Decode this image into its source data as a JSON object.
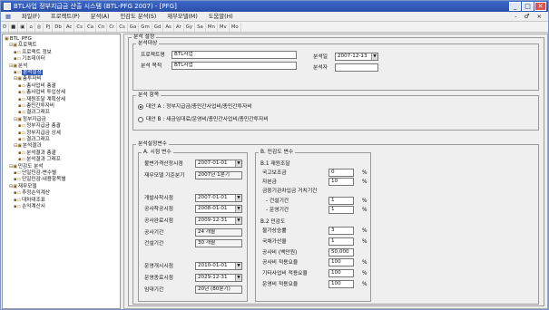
{
  "window": {
    "title": "BTL사업 정부지급금 산출 시스템 (BTL-PFG 2007) - [PFG]",
    "btn_min": "_",
    "btn_max": "□",
    "btn_close": "✕"
  },
  "menubar": {
    "items": [
      "파일(F)",
      "프로젝트(P)",
      "분석(A)",
      "민감도 분석(S)",
      "재무모델(M)",
      "도움말(H)"
    ],
    "mdi_controls": "- ♂ ×"
  },
  "toolbar": {
    "items": [
      "D",
      "■",
      "▣",
      "⌂",
      "◎",
      "Pj",
      "Db",
      "Ac",
      "Cs",
      "Ca",
      "Cn",
      "Cr",
      "Cs",
      "Ga",
      "Gm",
      "Gd",
      "As",
      "Ar",
      "Gy",
      "Sa",
      "Mn",
      "Mv",
      "Mo"
    ]
  },
  "tree": {
    "items": [
      {
        "label": "BTL_PFG",
        "gl": "▣"
      },
      {
        "label": "프로젝트",
        "gl": "⊟▣"
      },
      {
        "label": "프로젝트 정보",
        "gl": "▪▭"
      },
      {
        "label": "기초데이터",
        "gl": "▪▭"
      },
      {
        "label": "분석",
        "gl": "⊟▣"
      },
      {
        "label": "분석설정",
        "gl": "▪▭",
        "selected": true
      },
      {
        "label": "총투자비",
        "gl": "⊟▣"
      },
      {
        "label": "총사업비 총괄",
        "gl": "▪▭"
      },
      {
        "label": "총사업비 투입상세",
        "gl": "▪▭"
      },
      {
        "label": "재원조달 계획상세",
        "gl": "▪▭"
      },
      {
        "label": "총민간투자비",
        "gl": "▪▭"
      },
      {
        "label": "결과그래프",
        "gl": "▪▭"
      },
      {
        "label": "정부지급금",
        "gl": "⊟▣"
      },
      {
        "label": "정부지급금 총괄",
        "gl": "▪▭"
      },
      {
        "label": "정부지급금 상세",
        "gl": "▪▭"
      },
      {
        "label": "결과그래프",
        "gl": "▪▭"
      },
      {
        "label": "분석결과",
        "gl": "⊟▣"
      },
      {
        "label": "분석결과 총괄",
        "gl": "▪▭"
      },
      {
        "label": "분석결과 그래프",
        "gl": "▪▭"
      },
      {
        "label": "민감도 분석",
        "gl": "⊟▣"
      },
      {
        "label": "단일민감-변수별",
        "gl": "▪▭"
      },
      {
        "label": "단일민감-내용항목별",
        "gl": "▪▭"
      },
      {
        "label": "재무모델",
        "gl": "⊟▣"
      },
      {
        "label": "추정손익계산",
        "gl": "▪▭"
      },
      {
        "label": "대차대조표",
        "gl": "▪▭"
      },
      {
        "label": "손익계산서",
        "gl": "▪▭"
      }
    ]
  },
  "panel": {
    "title": "분석 설정",
    "target": {
      "title": "분석대상",
      "project_name_label": "프로젝트명",
      "project_name": "BTL사업",
      "analysis_purpose_label": "분석 목적",
      "analysis_purpose": "BTL사업",
      "date_label": "분석일",
      "date": "2007-12-13",
      "analyst_label": "분석자",
      "analyst": ""
    },
    "items": {
      "title": "분석 항목",
      "option_a": "대안 A : 정부지급금/총민간사업비/총민간투자비",
      "option_b": "대안 B : 새금임대료/운영비/총민간사업비/총민간투자비"
    },
    "variables": {
      "title": "분석설정변수",
      "time": {
        "title": "A. 시점 변수",
        "rows": [
          {
            "label": "불변가격산정시점",
            "value": "2007-01-01",
            "dd": true
          },
          {
            "label": "재무모델 기준분기",
            "value": "2007년 1분기",
            "dd": false
          },
          {
            "label": "",
            "value": "",
            "dd": false
          },
          {
            "label": "개발사착시점",
            "value": "2007-01-01",
            "dd": true
          },
          {
            "label": "공사착공시점",
            "value": "2008-01-01",
            "dd": true
          },
          {
            "label": "공사완료시점",
            "value": "2009-12-31",
            "dd": true
          },
          {
            "label": "공사기간",
            "value": "24 개월",
            "dd": false
          },
          {
            "label": "건설기간",
            "value": "30 개월",
            "dd": false
          },
          {
            "label": "",
            "value": "",
            "dd": false
          },
          {
            "label": "운영개시시점",
            "value": "2010-01-01",
            "dd": true
          },
          {
            "label": "운영종료시점",
            "value": "2029-12-31",
            "dd": true
          },
          {
            "label": "임대기간",
            "value": "20년 (80분기)",
            "dd": false
          }
        ]
      },
      "sensitivity": {
        "title": "B. 민감도 변수",
        "b1_title": "B.1 재원조달",
        "b1": [
          {
            "label": "국고보조금",
            "value": "0",
            "unit": "%"
          },
          {
            "label": "자본금",
            "value": "10",
            "unit": "%"
          },
          {
            "label": "금융기관차입금 거치기간",
            "value": "",
            "unit": ""
          },
          {
            "label": "- 건설기간",
            "value": "1",
            "unit": "%"
          },
          {
            "label": "- 운영기간",
            "value": "1",
            "unit": "%"
          }
        ],
        "b2_title": "B.2 민감도",
        "b2": [
          {
            "label": "물가상승률",
            "value": "3",
            "unit": "%"
          },
          {
            "label": "국채가산율",
            "value": "1",
            "unit": "%"
          },
          {
            "label": "공사비 (백만원)",
            "value": "50,000",
            "unit": ""
          },
          {
            "label": "공사비 적용요율",
            "value": "100",
            "unit": "%"
          },
          {
            "label": "기타사업비 적용요율",
            "value": "100",
            "unit": "%"
          },
          {
            "label": "운영비 적용요율",
            "value": "100",
            "unit": "%"
          }
        ]
      }
    }
  }
}
